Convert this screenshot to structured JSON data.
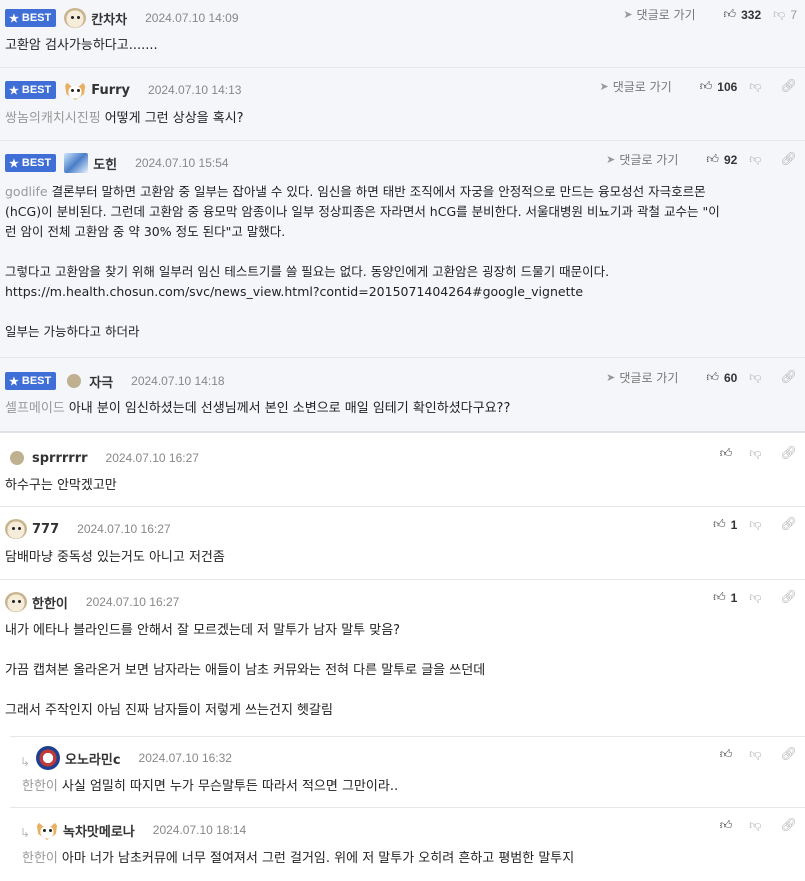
{
  "labels": {
    "best": "BEST",
    "goto": "댓글로 가기"
  },
  "comments": [
    {
      "nick": "칸차차",
      "date": "2024.07.10 14:09",
      "up": "332",
      "down": "7",
      "avatar": "dog-icon",
      "text": "고환암 검사가능하다고......."
    },
    {
      "nick": "Furry",
      "date": "2024.07.10 14:13",
      "up": "106",
      "avatar": "fox-icon",
      "tag": "쌍놈의캐치시진핑",
      "text": "어떻게 그런 상상을 혹시?"
    },
    {
      "nick": "도힌",
      "date": "2024.07.10 15:54",
      "up": "92",
      "avatar": "picture-avatar-icon",
      "tag": "godlife",
      "lines": [
        "결론부터 말하면 고환암 중 일부는 잡아낼 수 있다. 임신을 하면 태반 조직에서 자궁을 안정적으로 만드는 융모성선 자극호르몬",
        "(hCG)이 분비된다. 그런데 고환암 중 융모막 암종이나 일부 정상피종은 자라면서 hCG를 분비한다. 서울대병원 비뇨기과 곽철 교수는 \"이",
        "런 암이 전체 고환암 중 약 30% 정도 된다\"고 말했다.",
        "",
        "그렇다고 고환암을 찾기 위해 일부러 임신 테스트기를 쓸 필요는 없다. 동양인에게 고환암은 굉장히 드물기 때문이다.",
        "https://m.health.chosun.com/svc/news_view.html?contid=2015071404264#google_vignette",
        "",
        "일부는 가능하다고 하더라"
      ]
    },
    {
      "nick": "자극",
      "date": "2024.07.10 14:18",
      "up": "60",
      "avatar": "dot-avatar-icon",
      "tag": "셀프메이드",
      "text": "아내 분이 임신하셨는데 선생님께서 본인 소변으로 매일 임테기 확인하셨다구요??"
    },
    {
      "nick": "sprrrrrr",
      "date": "2024.07.10 16:27",
      "avatar": "dot-avatar-icon",
      "text": "하수구는 안막겠고만"
    },
    {
      "nick": "777",
      "date": "2024.07.10 16:27",
      "up": "1",
      "avatar": "dog-icon",
      "text": "담배마냥 중독성 있는거도 아니고 저건좀"
    },
    {
      "nick": "한한이",
      "date": "2024.07.10 16:27",
      "up": "1",
      "avatar": "dog-icon",
      "lines": [
        "내가 에타나 블라인드를 안해서 잘 모르겠는데 저 말투가 남자 말투 맞음?",
        "",
        "가끔 캡쳐본 올라온거 보면 남자라는 애들이 남초 커뮤와는 전혀 다른 말투로 글을 쓰던데",
        "",
        "그래서 주작인지 아님 진짜 남자들이 저렇게 쓰는건지 헷갈림"
      ]
    },
    {
      "nick": "오노라민c",
      "date": "2024.07.10 16:32",
      "avatar": "mask-avatar-icon",
      "tag": "한한이",
      "text": "사실 엄밀히 따지면 누가 무슨말투든 따라서 적으면 그만이라.."
    },
    {
      "nick": "녹차맛메로나",
      "date": "2024.07.10 18:14",
      "avatar": "fox-icon",
      "tag": "한한이",
      "text": "아마 너가 남초커뮤에 너무 절여져서 그런 걸거임. 위에 저 말투가 오히려 흔하고 평범한 말투지"
    }
  ]
}
